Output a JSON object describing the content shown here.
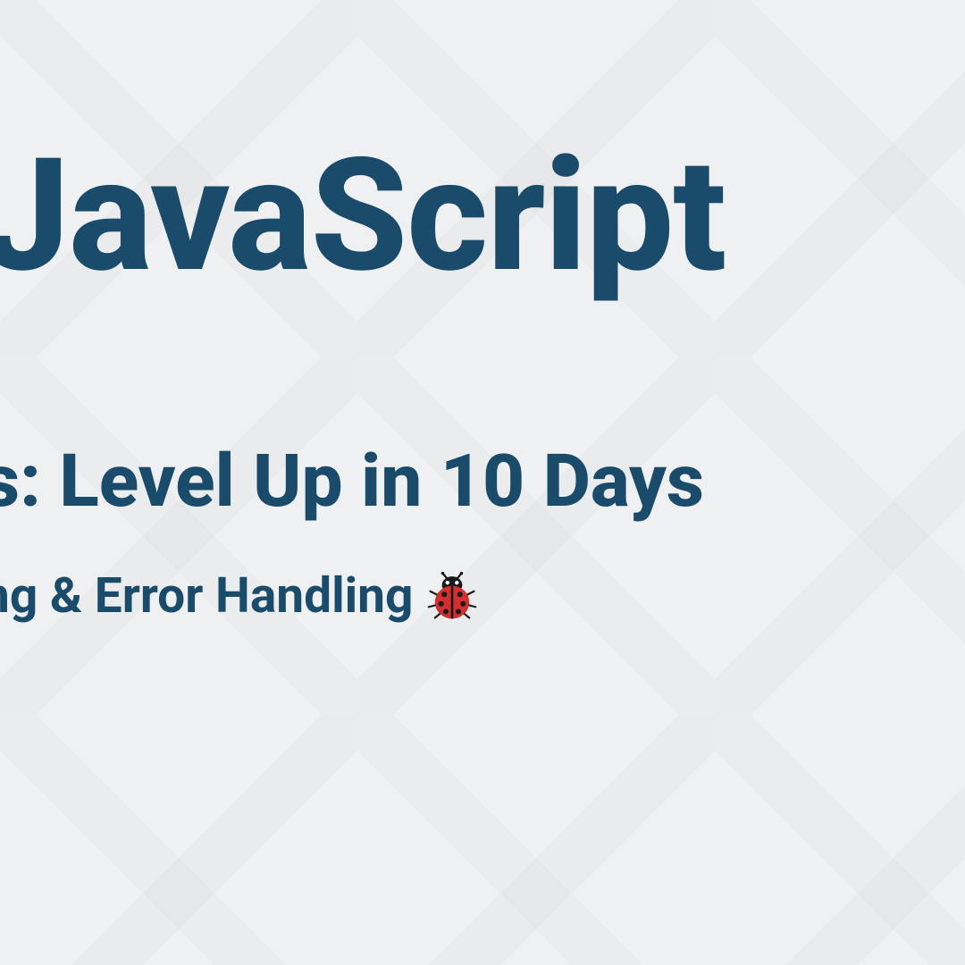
{
  "title": "JavaScript",
  "subtitle": "s: Level Up in 10 Days",
  "topic_text": "ng & Error Handling",
  "icon": "ladybug-icon",
  "colors": {
    "text": "#1b4b6b",
    "background": "#eef0f1"
  }
}
